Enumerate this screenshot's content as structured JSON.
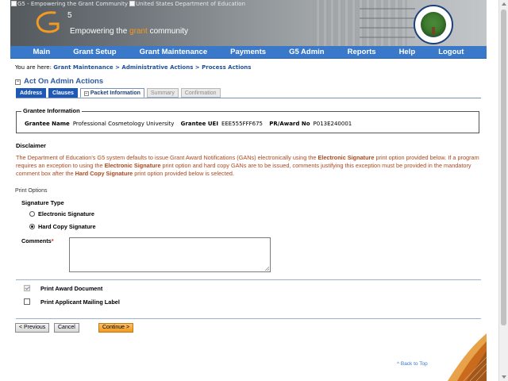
{
  "banner": {
    "broken_img_1": "G5 - Empowering the Grant Community",
    "broken_img_2": "United States Department of Education",
    "logo_text": "G",
    "logo_sup": "5",
    "tagline_pre": "Empowering the ",
    "tagline_grant": "grant",
    "tagline_post": " community"
  },
  "nav": {
    "items": [
      "Main",
      "Grant Setup",
      "Grant Maintenance",
      "Payments",
      "G5 Admin",
      "Reports",
      "Help",
      "Logout"
    ]
  },
  "breadcrumb": {
    "prefix": "You are here: ",
    "items": [
      "Grant Maintenance",
      "Administrative Actions",
      "Process Actions"
    ],
    "separator": " > "
  },
  "page": {
    "title": "Act On Admin Actions"
  },
  "tabs": [
    {
      "label": "Address",
      "state": "link"
    },
    {
      "label": "Clauses",
      "state": "link"
    },
    {
      "label": "Packet Information",
      "state": "active"
    },
    {
      "label": "Summary",
      "state": "disabled"
    },
    {
      "label": "Confirmation",
      "state": "disabled"
    }
  ],
  "grantee": {
    "section_title": "Grantee Information",
    "name_label": "Grantee Name",
    "name_value": "Professional Cosmetology University",
    "uei_label": "Grantee UEI",
    "uei_value": "EEE555FFF675",
    "award_label": "PR/Award No",
    "award_value": "P013E240001"
  },
  "disclaimer": {
    "heading": "Disclaimer",
    "p1": "The Department of Education's G5 system defaults to issue Grant Award Notifications (GANs) electronically using the ",
    "b1": "Electronic Signature",
    "p2": " print option provided below. If a program requires an exception to using the ",
    "b2": "Electronic Signature",
    "p3": " print option and hard copy GANs are to be issued, comments justifying this exception must be provided in the mandatory comment box after the ",
    "b3": "Hard Copy Signature",
    "p4": " print option provided below is selected."
  },
  "print_options": {
    "heading": "Print Options",
    "signature_type_label": "Signature Type",
    "electronic_label": "Electronic Signature",
    "electronic_selected": false,
    "hardcopy_label": "Hard Copy Signature",
    "hardcopy_selected": true,
    "comments_label": "Comments",
    "comments_required_mark": "*",
    "comments_value": "",
    "print_award_label": "Print Award Document",
    "print_award_checked": true,
    "print_mailing_label": "Print Applicant Mailing Label",
    "print_mailing_checked": false
  },
  "buttons": {
    "previous": "< Previous",
    "cancel": "Cancel",
    "continue": "Continue >"
  },
  "footer": {
    "back_to_top": "^ Back to Top"
  },
  "colors": {
    "nav_bg": "#3a78c9",
    "title": "#2f5aa0",
    "disclaimer_text": "#b0461c",
    "accent_orange": "#f39a21"
  }
}
